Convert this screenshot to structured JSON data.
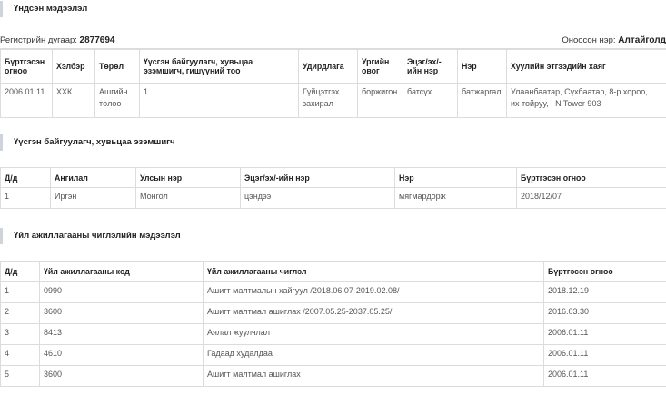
{
  "section1": {
    "title": "Үндсэн мэдээлэл"
  },
  "registration": {
    "label": "Регистрийн дугаар:",
    "number": "2877694",
    "name_label": "Оноосон нэр:",
    "name": "Алтайголд"
  },
  "main_table": {
    "headers": [
      "Бүртгэсэн огноо",
      "Хэлбэр",
      "Төрөл",
      "Үүсгэн байгуулагч, хувьцаа эзэмшигч, гишүүний тоо",
      "Удирдлага",
      "Ургийн овог",
      "Эцэг/эх/-ийн нэр",
      "Нэр",
      "Хуулийн этгээдийн хаяг"
    ],
    "row": [
      "2006.01.11",
      "ХХК",
      "Ашгийн төлөө",
      "1",
      "Гүйцэтгэх захирал",
      "боржигон",
      "батсүх",
      "батжаргал",
      "Улаанбаатар, Сүхбаатар, 8-р хороо, , их тойруу, , N Tower 903"
    ]
  },
  "section2": {
    "title": "Үүсгэн байгуулагч, хувьцаа эзэмшигч"
  },
  "founders_table": {
    "headers": [
      "Д/д",
      "Ангилал",
      "Улсын нэр",
      "Эцэг/эх/-ийн нэр",
      "Нэр",
      "Бүртгэсэн огноо"
    ],
    "rows": [
      [
        "1",
        "Иргэн",
        "Монгол",
        "цэндээ",
        "мягмардорж",
        "2018/12/07"
      ]
    ]
  },
  "section3": {
    "title": "Үйл ажиллагааны чиглэлийн мэдээлэл"
  },
  "activity_table": {
    "headers": [
      "Д/д",
      "Үйл ажиллагааны код",
      "Үйл ажиллагааны чиглэл",
      "Бүртгэсэн огноо"
    ],
    "rows": [
      [
        "1",
        "0990",
        "Ашигт малтмалын хайгуул /2018.06.07-2019.02.08/",
        "2018.12.19"
      ],
      [
        "2",
        "3600",
        "Ашигт малтмал ашиглах /2007.05.25-2037.05.25/",
        "2016.03.30"
      ],
      [
        "3",
        "8413",
        "Аялал жуулчлал",
        "2006.01.11"
      ],
      [
        "4",
        "4610",
        "Гадаад худалдаа",
        "2006.01.11"
      ],
      [
        "5",
        "3600",
        "Ашигт малтмал ашиглах",
        "2006.01.11"
      ]
    ]
  }
}
